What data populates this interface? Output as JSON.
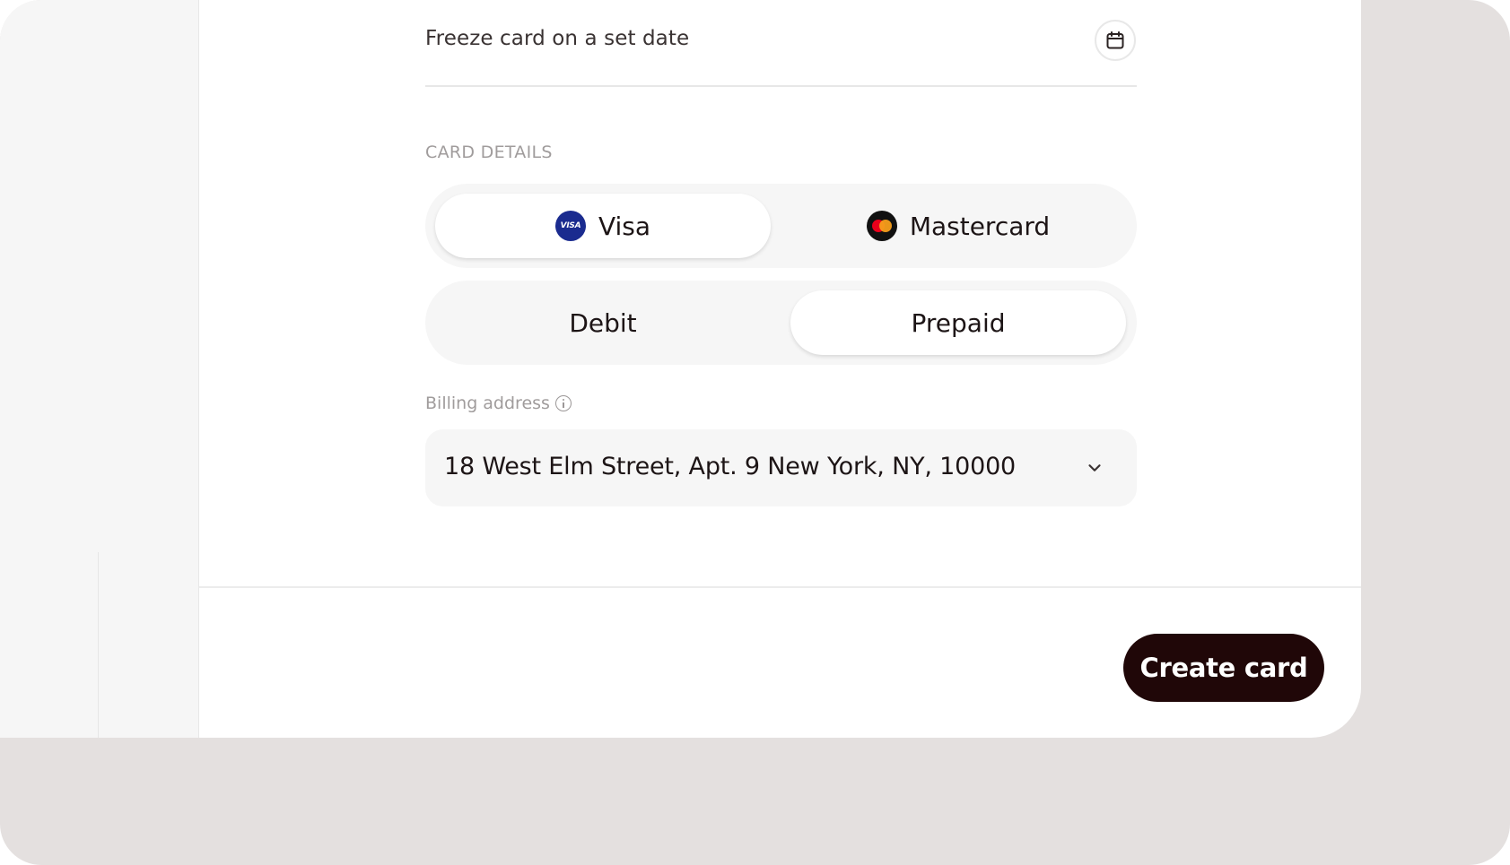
{
  "freeze": {
    "label": "Freeze card on a set date",
    "icon": "calendar-icon"
  },
  "card_details": {
    "section_label": "CARD DETAILS",
    "brands": [
      {
        "label": "Visa",
        "logo_text": "VISA",
        "selected": true
      },
      {
        "label": "Mastercard",
        "selected": false
      }
    ],
    "types": [
      {
        "label": "Debit",
        "selected": false
      },
      {
        "label": "Prepaid",
        "selected": true
      }
    ]
  },
  "billing": {
    "label": "Billing address",
    "value": "18 West Elm Street, Apt. 9 New York, NY, 10000"
  },
  "footer": {
    "create_label": "Create card"
  },
  "colors": {
    "primary_button": "#200708",
    "visa_blue": "#1a2b8f",
    "mastercard_red": "#eb001b",
    "mastercard_orange": "#f79e1b",
    "backdrop": "#e4e0df"
  }
}
